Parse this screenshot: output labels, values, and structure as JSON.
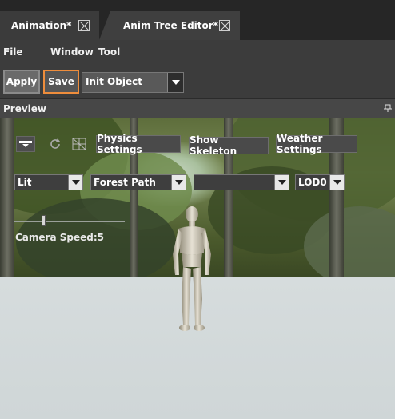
{
  "tabs": [
    {
      "label": "Animation*"
    },
    {
      "label": "Anim Tree Editor*"
    }
  ],
  "menu": {
    "file": "File",
    "window": "Window",
    "tool": "Tool"
  },
  "toolbar": {
    "apply_label": "Apply",
    "save_label": "Save",
    "object_select": "Init Object"
  },
  "preview": {
    "title": "Preview",
    "physics_settings": "Physics Settings",
    "show_skeleton": "Show Skeleton",
    "weather_settings": "Weather Settings",
    "lighting_mode": "Lit",
    "environment": "Forest Path",
    "empty_select": "",
    "lod": "LOD0",
    "camera_speed_label": "Camera Speed:5",
    "camera_speed_value": 5
  },
  "colors": {
    "save_highlight": "#ee8d3c",
    "panel_bg": "#3c3c3c",
    "tabbar_bg": "#262626"
  },
  "icons": {
    "tab_close": "close-icon",
    "dropdown": "chevron-down-icon",
    "pin": "pin-icon",
    "view_mode": "view-mode-icon",
    "refresh": "refresh-icon",
    "grid": "grid-icon"
  }
}
